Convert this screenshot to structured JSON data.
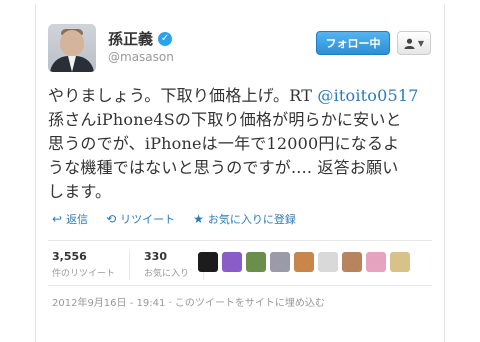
{
  "user": {
    "name": "孫正義",
    "handle": "@masason",
    "verified_mark": "✓",
    "follow_label": "フォロー中",
    "user_menu_icon": "user-dropdown-icon"
  },
  "tweet": {
    "lines": [
      [
        "やりましょう。下取り価格上げ。RT ",
        "@itoito0517"
      ],
      [
        "孫さんiPhone4Sの下取り価格が明らかに安いと"
      ],
      [
        "思うのでが、iPhoneは一年で12000円になるよ"
      ],
      [
        "うな機種ではないと思うのですが.... 返答お願い"
      ],
      [
        "します。"
      ]
    ],
    "mention": "@itoito0517"
  },
  "actions": {
    "reply": "返信",
    "retweet": "リツイート",
    "favorite": "お気に入りに登録"
  },
  "stats": {
    "retweets_count": "3,556",
    "retweets_label": "件のリツイート",
    "favorites_count": "330",
    "favorites_label": "お気に入り"
  },
  "faces": {
    "colors": [
      "#1c1c1c",
      "#8a5cc7",
      "#6b8f4a",
      "#9a9aa8",
      "#c8864a",
      "#d9d9d9",
      "#b8845e",
      "#e5a3c0",
      "#d8c28a"
    ]
  },
  "meta": {
    "timestamp": "2012年9月16日 - 19:41",
    "embed_link": "このツイートをサイトに埋め込む",
    "separator": "·"
  },
  "colors": {
    "link": "#2b7bb9",
    "follow_button": "#2b8fd8"
  }
}
